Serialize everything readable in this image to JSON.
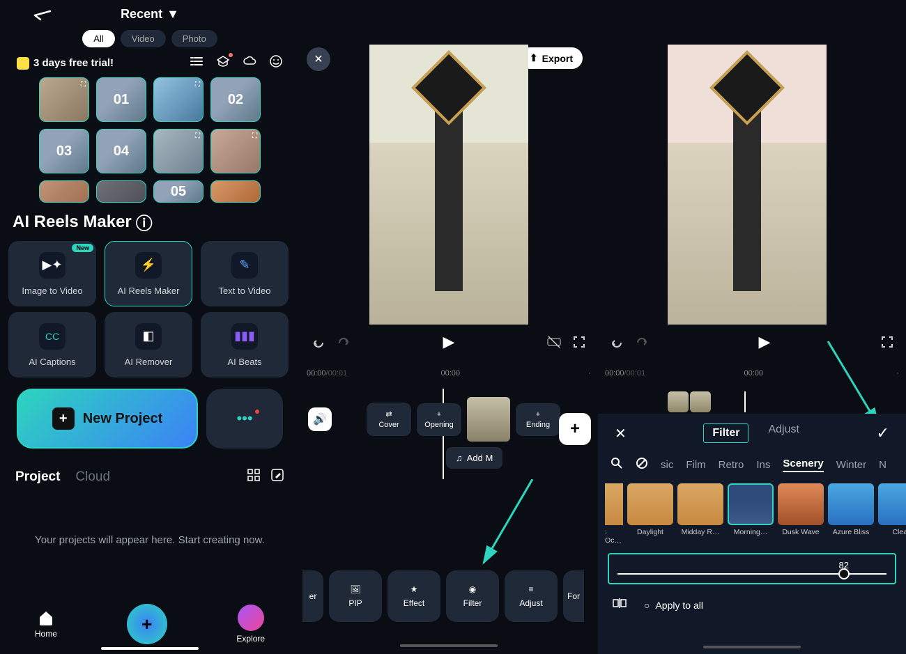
{
  "col1": {
    "recent_title": "Recent",
    "filter_tabs": {
      "all": "All",
      "video": "Video",
      "photo": "Photo"
    },
    "trial": "3 days free trial!",
    "grid_labels": [
      "01",
      "02",
      "03",
      "04",
      "05"
    ],
    "ai_title": "AI Reels Maker",
    "ai_items": {
      "img2vid": "Image to Video",
      "reels": "AI Reels Maker",
      "txt2vid": "Text  to Video",
      "captions": "AI Captions",
      "remover": "AI Remover",
      "beats": "AI Beats",
      "new_tag": "New"
    },
    "new_project": "New Project",
    "tabs": {
      "project": "Project",
      "cloud": "Cloud"
    },
    "empty_msg": "Your projects will appear here. Start creating now.",
    "nav": {
      "home": "Home",
      "explore": "Explore"
    }
  },
  "col2": {
    "export": "Export",
    "time_current": "00:00",
    "time_total": "/00:01",
    "time_marker": "00:00",
    "cover": "Cover",
    "opening": "Opening",
    "ending": "Ending",
    "add_music": "Add M",
    "tools": {
      "er": "er",
      "pip": "PIP",
      "effect": "Effect",
      "filter": "Filter",
      "adjust": "Adjust",
      "for": "For"
    }
  },
  "col3": {
    "time_current": "00:00",
    "time_total": "/00:01",
    "time_marker": "00:00",
    "tabs": {
      "filter": "Filter",
      "adjust": "Adjust"
    },
    "cats": {
      "sic": "sic",
      "film": "Film",
      "retro": "Retro",
      "ins": "Ins",
      "scenery": "Scenery",
      "winter": "Winter",
      "n": "N"
    },
    "filters": {
      "oc": ": Oc…",
      "daylight": "Daylight",
      "midday": "Midday R…",
      "morning": "Morning…",
      "dusk": "Dusk Wave",
      "azure": "Azure Bliss",
      "clear": "Clear"
    },
    "slider_value": "82",
    "apply_all": "Apply to all"
  }
}
